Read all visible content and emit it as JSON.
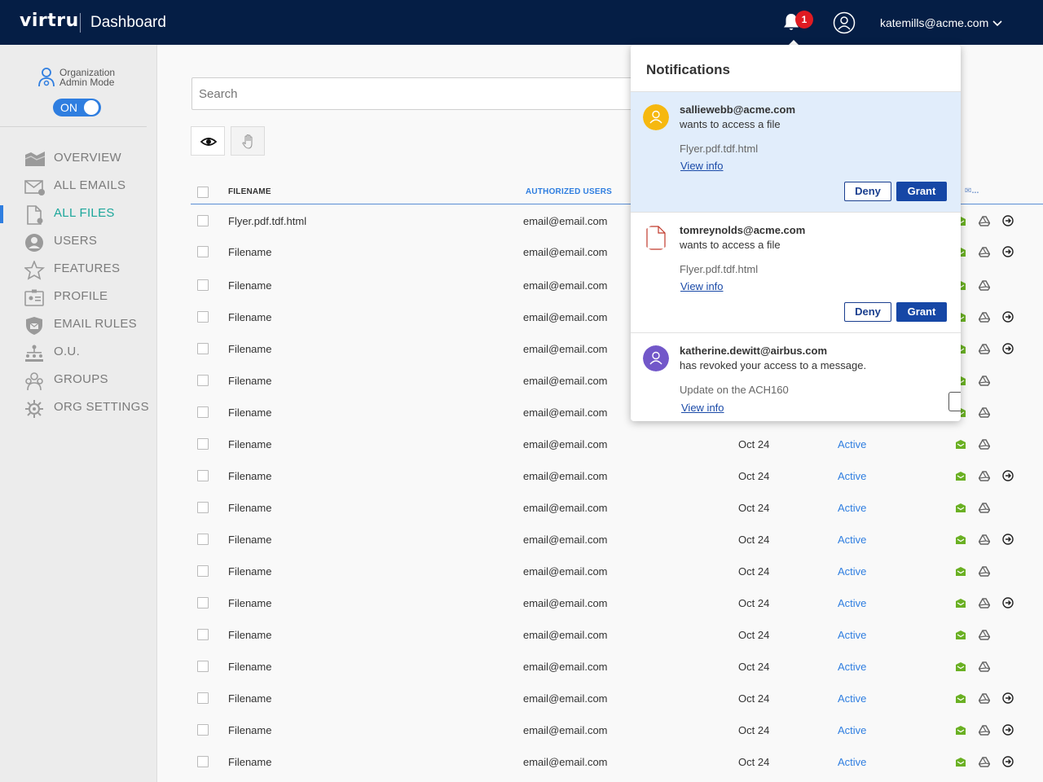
{
  "header": {
    "logo": "virtru",
    "title": "Dashboard",
    "notification_count": "1",
    "user_email": "katemills@acme.com"
  },
  "sidebar": {
    "admin_mode_label": "Organization Admin Mode",
    "toggle_label": "ON",
    "items": [
      {
        "label": "OVERVIEW",
        "icon": "overview-icon"
      },
      {
        "label": "ALL EMAILS",
        "icon": "emails-icon"
      },
      {
        "label": "ALL FILES",
        "icon": "files-icon",
        "active": true
      },
      {
        "label": "USERS",
        "icon": "users-icon"
      },
      {
        "label": "FEATURES",
        "icon": "star-icon"
      },
      {
        "label": "PROFILE",
        "icon": "profile-icon"
      },
      {
        "label": "EMAIL RULES",
        "icon": "shield-icon"
      },
      {
        "label": "O.U.",
        "icon": "org-tree-icon"
      },
      {
        "label": "GROUPS",
        "icon": "groups-icon"
      },
      {
        "label": "ORG SETTINGS",
        "icon": "gear-icon"
      }
    ]
  },
  "search": {
    "placeholder": "Search"
  },
  "table": {
    "columns": {
      "filename": "FILENAME",
      "users": "AUTHORIZED USERS",
      "extra": "✉..."
    },
    "rows": [
      {
        "file": "Flyer.pdf.tdf.html",
        "user": "email@email.com",
        "date": "",
        "status": "",
        "go": true
      },
      {
        "file": "Filename",
        "user": "email@email.com",
        "date": "",
        "status": "",
        "go": true
      },
      {
        "file": "Filename",
        "user": "email@email.com",
        "date": "",
        "status": "",
        "go": false
      },
      {
        "file": "Filename",
        "user": "email@email.com",
        "date": "",
        "status": "",
        "go": true
      },
      {
        "file": "Filename",
        "user": "email@email.com",
        "date": "",
        "status": "",
        "go": true
      },
      {
        "file": "Filename",
        "user": "email@email.com",
        "date": "",
        "status": "",
        "go": false
      },
      {
        "file": "Filename",
        "user": "email@email.com",
        "date": "",
        "status": "",
        "go": false
      },
      {
        "file": "Filename",
        "user": "email@email.com",
        "date": "Oct 24",
        "status": "Active",
        "go": false
      },
      {
        "file": "Filename",
        "user": "email@email.com",
        "date": "Oct 24",
        "status": "Active",
        "go": true
      },
      {
        "file": "Filename",
        "user": "email@email.com",
        "date": "Oct 24",
        "status": "Active",
        "go": false
      },
      {
        "file": "Filename",
        "user": "email@email.com",
        "date": "Oct 24",
        "status": "Active",
        "go": true
      },
      {
        "file": "Filename",
        "user": "email@email.com",
        "date": "Oct 24",
        "status": "Active",
        "go": false
      },
      {
        "file": "Filename",
        "user": "email@email.com",
        "date": "Oct 24",
        "status": "Active",
        "go": true
      },
      {
        "file": "Filename",
        "user": "email@email.com",
        "date": "Oct 24",
        "status": "Active",
        "go": false
      },
      {
        "file": "Filename",
        "user": "email@email.com",
        "date": "Oct 24",
        "status": "Active",
        "go": false
      },
      {
        "file": "Filename",
        "user": "email@email.com",
        "date": "Oct 24",
        "status": "Active",
        "go": true
      },
      {
        "file": "Filename",
        "user": "email@email.com",
        "date": "Oct 24",
        "status": "Active",
        "go": true
      },
      {
        "file": "Filename",
        "user": "email@email.com",
        "date": "Oct 24",
        "status": "Active",
        "go": true
      }
    ]
  },
  "notifications": {
    "title": "Notifications",
    "items": [
      {
        "email": "salliewebb@acme.com",
        "message": "wants to access a file",
        "subject": "Flyer.pdf.tdf.html",
        "link": "View info",
        "deny": "Deny",
        "grant": "Grant",
        "avatar_color": "#f6b80f",
        "highlighted": true
      },
      {
        "email": "tomreynolds@acme.com",
        "message": "wants to access a file",
        "subject": "Flyer.pdf.tdf.html",
        "link": "View info",
        "deny": "Deny",
        "grant": "Grant",
        "avatar": "file-icon"
      },
      {
        "email": "katherine.dewitt@airbus.com",
        "message": "has revoked your access to a message.",
        "subject": "Update on the ACH160",
        "link": "View info",
        "avatar_color": "#7257c9"
      }
    ]
  },
  "colors": {
    "header_bg": "#051e45",
    "accent_blue": "#2f7ee0",
    "active_teal": "#1ca79b",
    "grant_blue": "#1647a6",
    "highlight_bg": "#e1edfb",
    "badge_red": "#e01b22",
    "lock_green": "#6ab023"
  }
}
